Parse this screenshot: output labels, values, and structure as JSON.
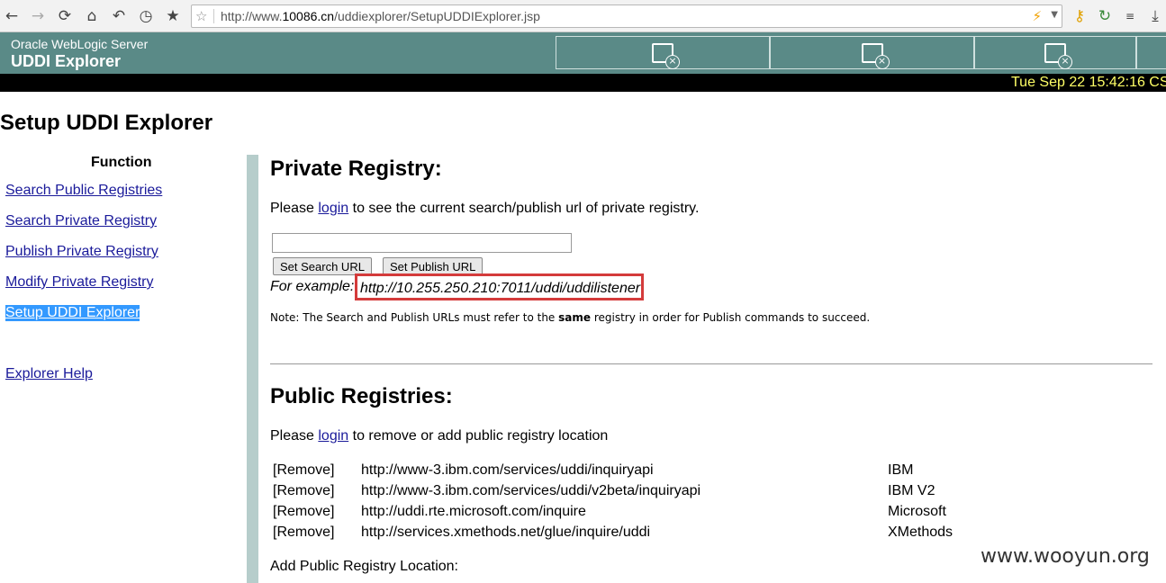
{
  "browser": {
    "url_prefix": "http://www.",
    "url_domain": "10086.cn",
    "url_path": "/uddiexplorer/SetupUDDIExplorer.jsp",
    "icons": [
      "back-icon",
      "forward-icon",
      "reload-icon",
      "home-icon",
      "undo-icon",
      "history-icon",
      "bookmark-star-icon"
    ]
  },
  "banner": {
    "subtitle": "Oracle WebLogic Server",
    "title": "UDDI Explorer",
    "datetime": "Tue Sep 22 15:42:16 CS"
  },
  "page_title": "Setup UDDI Explorer",
  "nav": {
    "heading": "Function",
    "items": [
      {
        "label": "Search Public Registries"
      },
      {
        "label": "Search Private Registry"
      },
      {
        "label": "Publish Private Registry"
      },
      {
        "label": "Modify Private Registry"
      },
      {
        "label": "Setup UDDI Explorer",
        "selected": true
      }
    ],
    "help": "Explorer Help"
  },
  "private_registry": {
    "heading": "Private Registry:",
    "login_pre": "Please ",
    "login_link": "login",
    "login_post": " to see the current search/publish url of private registry.",
    "input_value": "",
    "set_search_label": "Set Search URL",
    "set_publish_label": "Set Publish URL",
    "example_label": "For example:",
    "example_url": "http://10.255.250.210:7011/uddi/uddilistener",
    "note_pre": "Note: The Search and Publish URLs must refer to the ",
    "note_bold": "same",
    "note_post": " registry in order for Publish commands to succeed."
  },
  "public_registries": {
    "heading": "Public Registries:",
    "login_pre": "Please ",
    "login_link": "login",
    "login_post": " to remove or add public registry location",
    "rows": [
      {
        "action": "[Remove]",
        "url": "http://www-3.ibm.com/services/uddi/inquiryapi",
        "name": "IBM"
      },
      {
        "action": "[Remove]",
        "url": "http://www-3.ibm.com/services/uddi/v2beta/inquiryapi",
        "name": "IBM V2"
      },
      {
        "action": "[Remove]",
        "url": "http://uddi.rte.microsoft.com/inquire",
        "name": "Microsoft"
      },
      {
        "action": "[Remove]",
        "url": "http://services.xmethods.net/glue/inquire/uddi",
        "name": "XMethods"
      }
    ],
    "add_label": "Add Public Registry Location:"
  },
  "watermark": "www.wooyun.org"
}
